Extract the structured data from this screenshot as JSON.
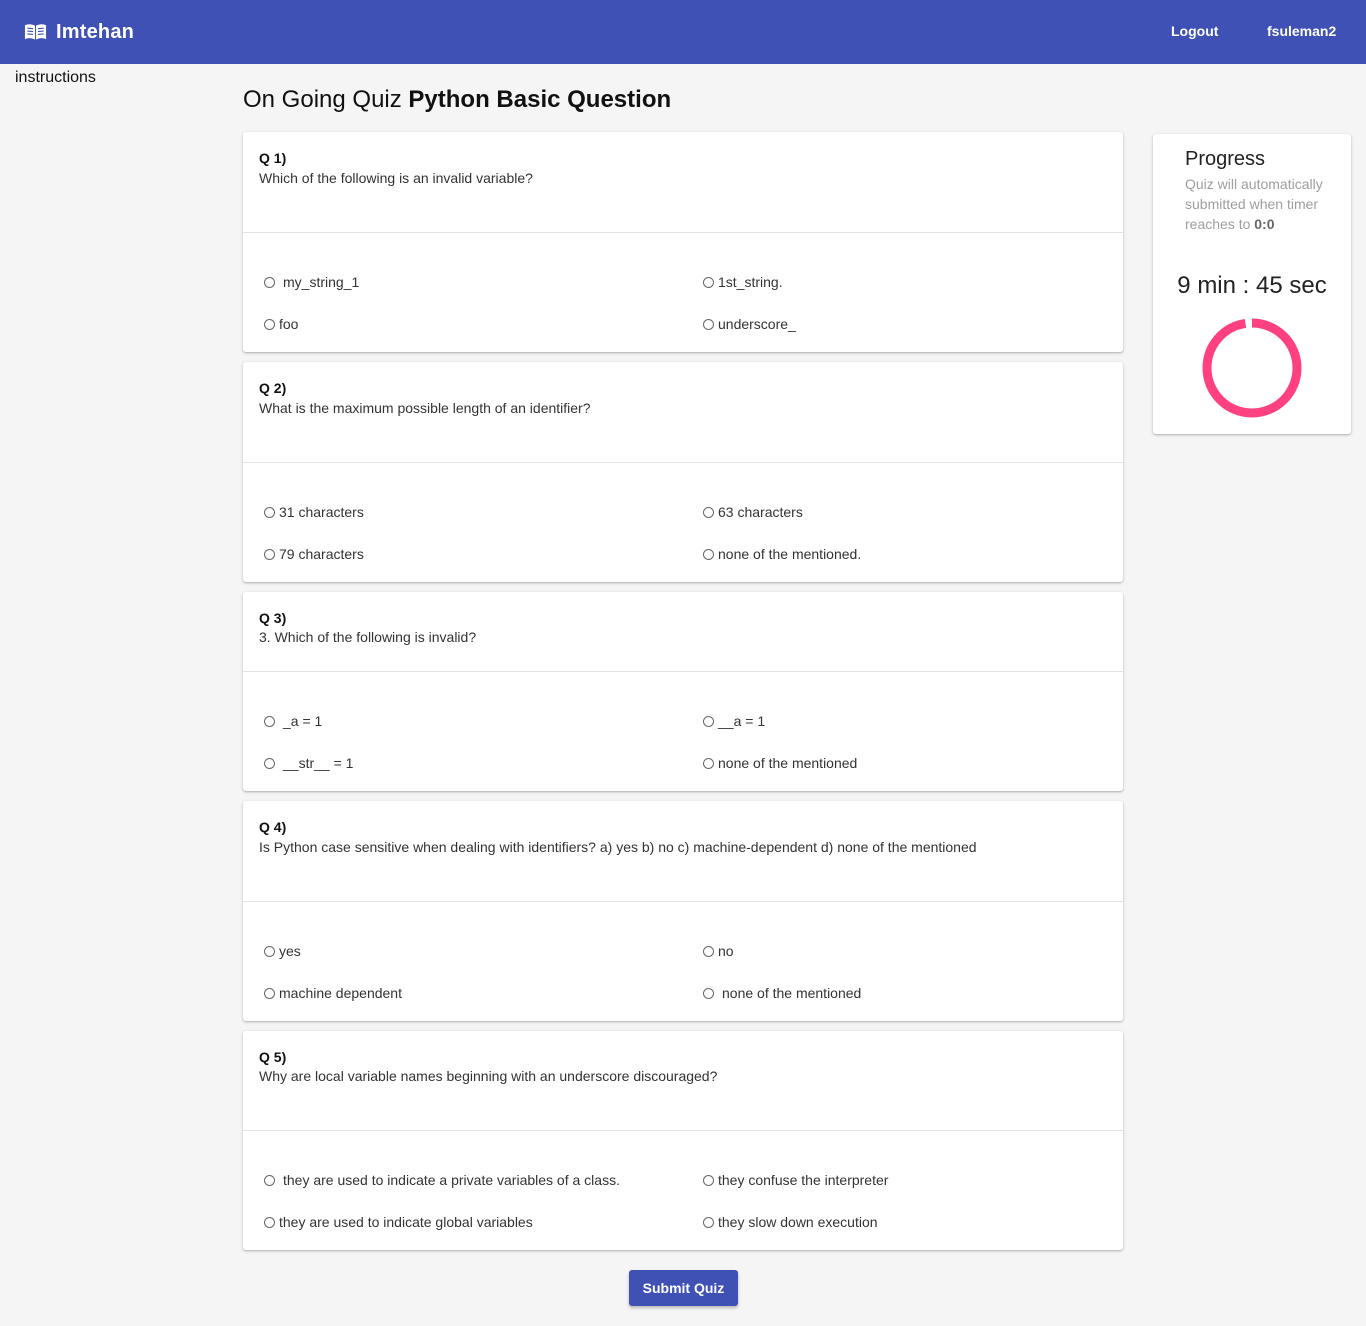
{
  "app": {
    "title": "Imtehan",
    "logo_icon": "book-icon"
  },
  "nav": {
    "logout_label": "Logout",
    "username": "fsuleman2"
  },
  "sidebar": {
    "instructions_label": "instructions"
  },
  "page": {
    "title_prefix": "On Going Quiz",
    "quiz_name": "Python Basic Question"
  },
  "questions": [
    {
      "number": "Q 1)",
      "text": "Which of the following is an invalid variable?",
      "options": [
        "my_string_1",
        "1st_string.",
        "foo",
        "underscore_"
      ]
    },
    {
      "number": "Q 2)",
      "text": "What is the maximum possible length of an identifier?",
      "options": [
        "31 characters",
        "63 characters",
        "79 characters",
        "none of the mentioned."
      ]
    },
    {
      "number": "Q 3)",
      "text": "3. Which of the following is invalid?",
      "options": [
        "_a = 1",
        "__a = 1",
        "__str__ = 1",
        "none of the mentioned"
      ]
    },
    {
      "number": "Q 4)",
      "text": "Is Python case sensitive when dealing with identifiers? a) yes b) no c) machine-dependent d) none of the mentioned",
      "options": [
        "yes",
        "no",
        "machine dependent",
        "none of the mentioned"
      ]
    },
    {
      "number": "Q 5)",
      "text": "Why are local variable names beginning with an underscore discouraged?",
      "options": [
        "they are used to indicate a private variables of a class.",
        "they confuse the interpreter",
        "they are used to indicate global variables",
        "they slow down execution"
      ]
    }
  ],
  "progress": {
    "title": "Progress",
    "description": "Quiz will automatically submitted when timer reaches to",
    "deadline": "0:0",
    "timer": "9 min : 45 sec",
    "ring_fraction": 0.975,
    "ring_color": "#ff4081"
  },
  "submit_label": "Submit Quiz",
  "colors": {
    "primary": "#3f51b5",
    "accent": "#ff4081",
    "background": "#f5f5f5"
  }
}
